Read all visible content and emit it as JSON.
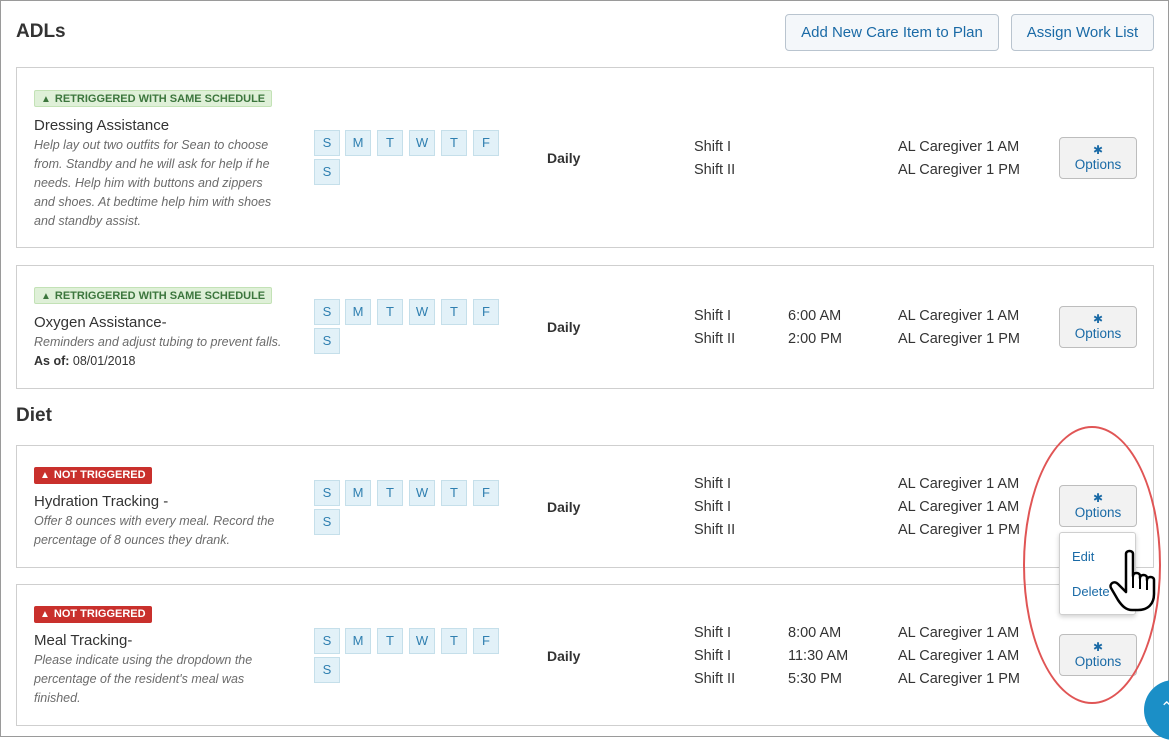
{
  "sections": {
    "adls_title": "ADLs",
    "diet_title": "Diet"
  },
  "header_buttons": {
    "add_new": "Add New Care Item to Plan",
    "assign": "Assign Work List"
  },
  "days": [
    "S",
    "M",
    "T",
    "W",
    "T",
    "F",
    "S"
  ],
  "options_label": "Options",
  "dropdown": {
    "edit": "Edit",
    "delete": "Delete"
  },
  "cards": [
    {
      "badge": "RETRIGGERED WITH SAME SCHEDULE",
      "badge_color": "#dff0d8",
      "title": "Dressing Assistance",
      "description": [
        "Help lay out two outfits for Sean to choose",
        "from. Standby and he will ask for help if he",
        "needs. Help him with buttons and zippers",
        "and shoes. At bedtime help him with shoes",
        "and standby assist."
      ],
      "frequency": "Daily",
      "shifts": [
        "Shift I",
        "Shift II"
      ],
      "times": [],
      "caregivers": [
        "AL Caregiver 1 AM",
        "AL Caregiver 1 PM"
      ]
    },
    {
      "badge": "RETRIGGERED WITH SAME SCHEDULE",
      "badge_color": "#dff0d8",
      "title": "Oxygen Assistance-",
      "description": [
        "Reminders and adjust tubing to prevent falls."
      ],
      "asof_label": "As of:",
      "asof_value": "08/01/2018",
      "frequency": "Daily",
      "shifts": [
        "Shift I",
        "Shift II"
      ],
      "times": [
        "6:00 AM",
        "2:00 PM"
      ],
      "caregivers": [
        "AL Caregiver 1 AM",
        "AL Caregiver 1 PM"
      ]
    },
    {
      "badge": "NOT TRIGGERED",
      "badge_color": "#c9302c",
      "title": "Hydration Tracking -",
      "description": [
        "Offer 8 ounces with every meal. Record the",
        "percentage of 8 ounces they drank."
      ],
      "frequency": "Daily",
      "shifts": [
        "Shift I",
        "Shift I",
        "Shift II"
      ],
      "times": [],
      "caregivers": [
        "AL Caregiver 1 AM",
        "AL Caregiver 1 AM",
        "AL Caregiver 1 PM"
      ]
    },
    {
      "badge": "NOT TRIGGERED",
      "badge_color": "#c9302c",
      "title": "Meal Tracking-",
      "description": [
        "Please indicate using the dropdown the",
        "percentage of the resident's meal was",
        "finished."
      ],
      "frequency": "Daily",
      "shifts": [
        "Shift I",
        "Shift I",
        "Shift II"
      ],
      "times": [
        "8:00 AM",
        "11:30 AM",
        "5:30 PM"
      ],
      "caregivers": [
        "AL Caregiver 1 AM",
        "AL Caregiver 1 AM",
        "AL Caregiver 1 PM"
      ]
    }
  ]
}
